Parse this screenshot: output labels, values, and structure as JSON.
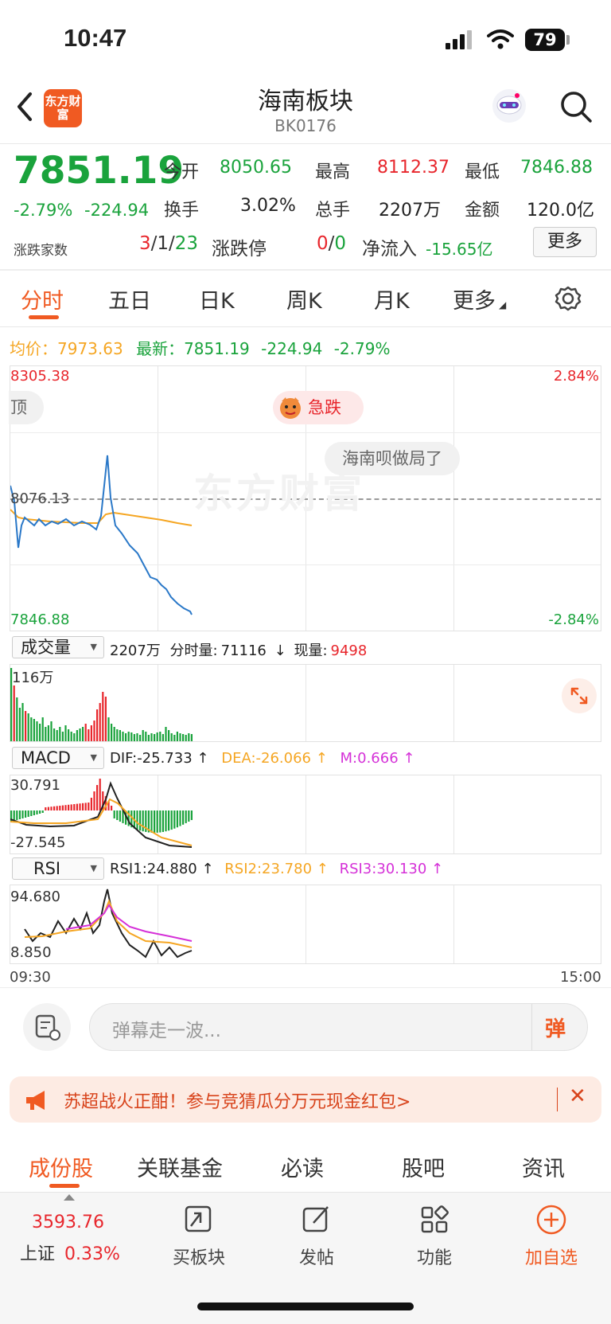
{
  "status_bar": {
    "time": "10:47",
    "battery": "79"
  },
  "header": {
    "logo_text": "东方财富",
    "title": "海南板块",
    "code": "BK0176"
  },
  "quote": {
    "price": "7851.19",
    "change_pct": "-2.79%",
    "change": "-224.94",
    "open_label": "今开",
    "open": "8050.65",
    "high_label": "最高",
    "high": "8112.37",
    "low_label": "最低",
    "low": "7846.88",
    "turnover_label": "换手",
    "turnover": "3.02%",
    "volume_label": "总手",
    "volume": "2207万",
    "amount_label": "金额",
    "amount": "120.0亿",
    "breadth_label": "涨跌家数",
    "breadth_up": "3",
    "breadth_flat": "1",
    "breadth_down": "23",
    "limit_label": "涨跌停",
    "limit_up": "0",
    "limit_down": "0",
    "net_inflow_label": "净流入",
    "net_inflow": "-15.65亿",
    "more_label": "更多"
  },
  "tabs": [
    {
      "label": "分时"
    },
    {
      "label": "五日"
    },
    {
      "label": "日K"
    },
    {
      "label": "周K"
    },
    {
      "label": "月K"
    },
    {
      "label": "更多"
    }
  ],
  "chart_info": {
    "avg_label": "均价：",
    "avg": "7973.63",
    "last_label": "最新：",
    "last": "7851.19",
    "last_change": "-224.94",
    "last_pct": "-2.79%"
  },
  "price_chart": {
    "y_top": "8305.38",
    "y_mid": "8076.13",
    "y_bottom": "7846.88",
    "pct_top": "2.84%",
    "pct_bottom": "-2.84%",
    "danmu_left": "顶",
    "alert_label": "急跌",
    "danmu_bubble": "海南呗做局了",
    "watermark": "东方财富"
  },
  "volume_panel": {
    "selector": "成交量",
    "total": "2207万",
    "minute_label": "分时量:",
    "minute_val": "71116",
    "now_label": "现量:",
    "now_val": "9498",
    "y_max": "116万"
  },
  "macd_panel": {
    "selector": "MACD",
    "dif": "DIF:-25.733 ↑",
    "dea": "DEA:-26.066 ↑",
    "m": "M:0.666 ↑",
    "y_top": "30.791",
    "y_bottom": "-27.545"
  },
  "rsi_panel": {
    "selector": "RSI",
    "rsi1": "RSI1:24.880 ↑",
    "rsi2": "RSI2:23.780 ↑",
    "rsi3": "RSI3:30.130 ↑",
    "y_top": "94.680",
    "y_bottom": "8.850"
  },
  "time_axis": {
    "start": "09:30",
    "end": "15:00"
  },
  "comment_bar": {
    "placeholder": "弹幕走一波...",
    "danmu_button": "弹"
  },
  "promo": {
    "text": "苏超战火正酣！参与竞猜瓜分万元现金红包>"
  },
  "sub_tabs": [
    {
      "label": "成份股"
    },
    {
      "label": "关联基金"
    },
    {
      "label": "必读"
    },
    {
      "label": "股吧"
    },
    {
      "label": "资讯"
    }
  ],
  "bottom_bar": {
    "index_value": "3593.76",
    "index_name": "上证",
    "index_pct": "0.33%",
    "items": [
      {
        "label": "买板块"
      },
      {
        "label": "发帖"
      },
      {
        "label": "功能"
      },
      {
        "label": "加自选"
      }
    ]
  },
  "colors": {
    "accent": "#f05a22",
    "up": "#e8262c",
    "down": "#1aa33c",
    "avg_line": "#f5a623",
    "price_line": "#2a78c8"
  }
}
